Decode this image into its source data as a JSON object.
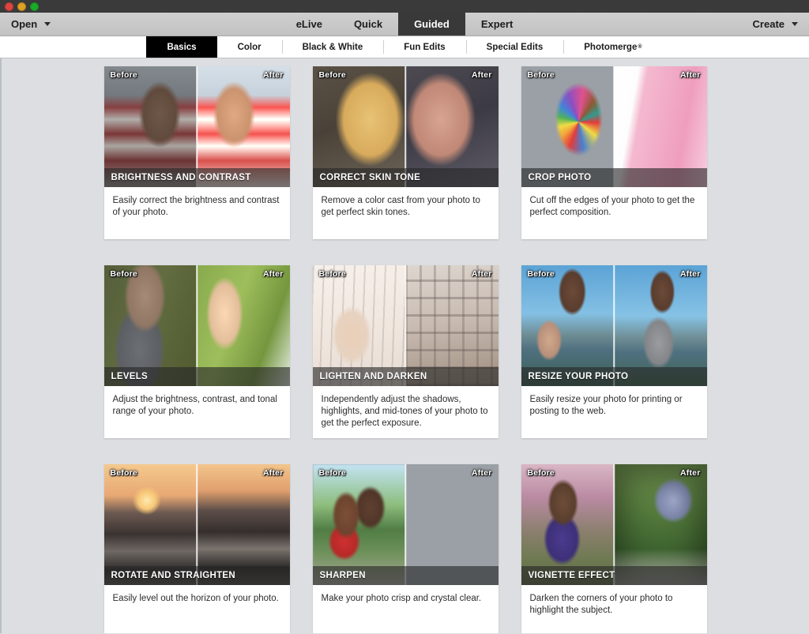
{
  "window": {
    "traffic_lights": [
      {
        "name": "close",
        "glyph": "×",
        "color": "#e0443e"
      },
      {
        "name": "minimize",
        "glyph": "−",
        "color": "#dea123"
      },
      {
        "name": "maximize",
        "glyph": "+",
        "color": "#1aab29"
      }
    ]
  },
  "menubar": {
    "open_label": "Open",
    "create_label": "Create",
    "mode_tabs": [
      {
        "label": "eLive",
        "active": false
      },
      {
        "label": "Quick",
        "active": false
      },
      {
        "label": "Guided",
        "active": true
      },
      {
        "label": "Expert",
        "active": false
      }
    ]
  },
  "subtabs": [
    {
      "label": "Basics",
      "active": true,
      "sup": ""
    },
    {
      "label": "Color",
      "active": false,
      "sup": ""
    },
    {
      "label": "Black & White",
      "active": false,
      "sup": ""
    },
    {
      "label": "Fun Edits",
      "active": false,
      "sup": ""
    },
    {
      "label": "Special Edits",
      "active": false,
      "sup": ""
    },
    {
      "label": "Photomerge",
      "active": false,
      "sup": "®"
    }
  ],
  "labels": {
    "before": "Before",
    "after": "After"
  },
  "colors": {
    "background": "#dcdee1",
    "active_tab": "#000000",
    "mode_tab_active": "#393939",
    "menubar": "#c9c9c9",
    "card": "#ffffff",
    "title_overlay": "rgba(38,38,38,0.62)"
  },
  "cards": [
    {
      "title": "BRIGHTNESS AND CONTRAST",
      "description": "Easily correct the brightness and contrast of your photo.",
      "art_left": "art-bc-l",
      "art_right": "art-bc-r"
    },
    {
      "title": "CORRECT SKIN TONE",
      "description": "Remove a color cast from your photo to get perfect skin tones.",
      "art_left": "art-st-l",
      "art_right": "art-st-r"
    },
    {
      "title": "CROP PHOTO",
      "description": "Cut off the edges of your photo to get the perfect composition.",
      "art_left": "art-cp-l",
      "art_right": "art-cp-r"
    },
    {
      "title": "LEVELS",
      "description": "Adjust the brightness, contrast, and tonal range of your photo.",
      "art_left": "art-lv-l",
      "art_right": "art-lv-r"
    },
    {
      "title": "LIGHTEN AND DARKEN",
      "description": "Independently adjust the shadows, highlights, and mid-tones of your photo to get the perfect exposure.",
      "art_left": "art-ld-l",
      "art_right": "art-ld-r"
    },
    {
      "title": "RESIZE YOUR PHOTO",
      "description": "Easily resize your photo for printing or posting to the web.",
      "art_left": "art-rs-l",
      "art_right": "art-rs-r"
    },
    {
      "title": "ROTATE AND STRAIGHTEN",
      "description": "Easily level out the horizon of your photo.",
      "art_left": "art-rt-l",
      "art_right": "art-rt-r"
    },
    {
      "title": "SHARPEN",
      "description": "Make your photo crisp and crystal clear.",
      "art_left": "art-sp-l",
      "art_right": "art-sp-r"
    },
    {
      "title": "VIGNETTE EFFECT",
      "description": "Darken the corners of your photo to highlight the subject.",
      "art_left": "art-vg-l",
      "art_right": "art-vg-r"
    }
  ]
}
